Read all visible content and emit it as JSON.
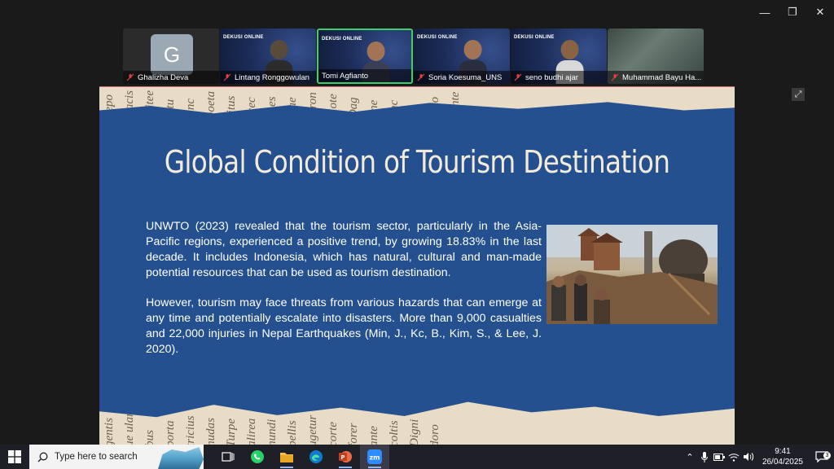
{
  "window_controls": {
    "minimize": "—",
    "restore": "❐",
    "close": "✕"
  },
  "participants": [
    {
      "name": "Ghalizha Deva",
      "avatar_letter": "G",
      "type": "avatar"
    },
    {
      "name": "Lintang Ronggowulan",
      "type": "video",
      "brand": "DEKUSI ONLINE"
    },
    {
      "name": "Tomi Agfianto",
      "type": "video",
      "brand": "DEKUSI ONLINE",
      "active": true
    },
    {
      "name": "Soria Koesuma_UNS",
      "type": "video",
      "brand": "DEKUSI ONLINE"
    },
    {
      "name": "seno budhi ajar",
      "type": "video",
      "brand": "DEKUSI ONLINE"
    },
    {
      "name": "Muhammad Bayu Ha...",
      "type": "scene"
    }
  ],
  "slide": {
    "title": "Global Condition of Tourism Destination",
    "paragraphs": [
      "UNWTO (2023) revealed that the tourism sector, particularly in the Asia-Pacific regions, experienced a positive trend, by growing 18.83% in the last decade. It includes Indonesia, which has natural, cultural and man-made potential resources that can be used as tourism destination.",
      "However, tourism may face threats from various hazards that can emerge at any time and potentially escalate into disasters. More than 9,000 casualties and 22,000 injuries in Nepal Earthquakes (Min, J., Kc, B., Kim, S., & Lee, J. 2020)."
    ],
    "paper_words_top": [
      "Sepo",
      "iracis",
      "rvitee",
      "bitu",
      "sinc",
      "poeta",
      "ritus",
      "scec",
      "enes",
      "niae",
      "foron",
      "diote",
      "Dag",
      "tine",
      "tinc",
      "fic",
      "m to",
      "gente"
    ],
    "paper_words_bottom": [
      "gentis",
      "ue ulam",
      "bus",
      "porta",
      "tricius",
      "nudas",
      "Turpe",
      "alirea",
      "nundi",
      "pellis",
      "ugetur",
      "corte",
      "forer",
      "ante",
      "coltis",
      "Digni",
      "doro"
    ]
  },
  "taskbar": {
    "search_placeholder": "Type here to search",
    "time": "9:41",
    "date": "26/04/2025",
    "notification_count": "3"
  },
  "colors": {
    "slide_bg": "#24508f",
    "paper": "#e8dcc6",
    "title": "#f3ead8",
    "active_border": "#3ccf6e"
  }
}
